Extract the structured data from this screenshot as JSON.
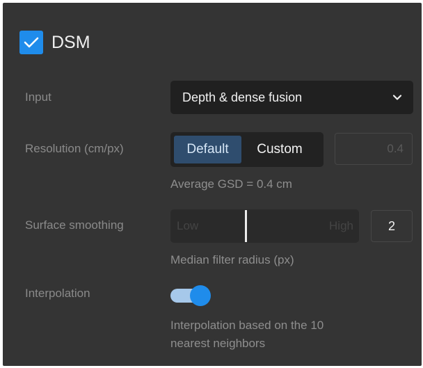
{
  "dsm": {
    "label": "DSM",
    "checked": true,
    "check_icon": "check-icon"
  },
  "input": {
    "label": "Input",
    "value": "Depth & dense fusion",
    "icon": "chevron-down-icon"
  },
  "resolution": {
    "label": "Resolution (cm/px)",
    "options": [
      "Default",
      "Custom"
    ],
    "selected": "Default",
    "value": "0.4",
    "hint": "Average GSD = 0.4 cm"
  },
  "smoothing": {
    "label": "Surface smoothing",
    "low_label": "Low",
    "high_label": "High",
    "value": "2",
    "level": 0.4,
    "hint": "Median filter radius (px)"
  },
  "interpolation": {
    "label": "Interpolation",
    "enabled": true,
    "hint_line1": "Interpolation based on the 10",
    "hint_line2": "nearest neighbors"
  },
  "colors": {
    "panel": "#343434",
    "accent": "#1f8ceb",
    "selected_segment": "#2f4d6e",
    "toggle_track": "#a6c8ea"
  }
}
